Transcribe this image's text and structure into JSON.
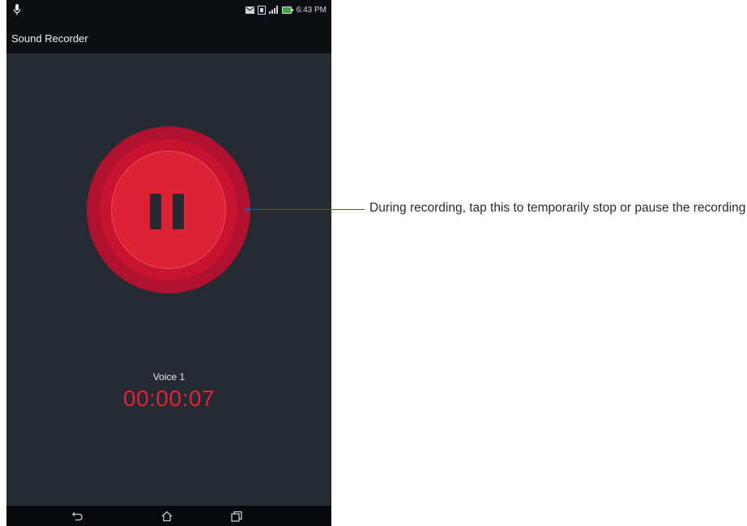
{
  "status_bar": {
    "time": "6:43 PM",
    "icons": [
      "mic-icon",
      "mail-icon",
      "sim-icon",
      "signal-icon",
      "battery-icon"
    ]
  },
  "app_bar": {
    "title": "Sound Recorder"
  },
  "recorder": {
    "pause_button_icon": "pause-icon",
    "voice_name": "Voice 1",
    "timer": "00:00:07"
  },
  "nav_bar": {
    "icons": [
      "back-icon",
      "home-icon",
      "recent-apps-icon"
    ]
  },
  "callout": {
    "text": "During recording, tap this to temporarily stop or pause the recording"
  },
  "colors": {
    "accent_red": "#dc2233",
    "timer_red": "#e0223a",
    "background": "#262a33",
    "callout_line": "#1a5fa6"
  }
}
